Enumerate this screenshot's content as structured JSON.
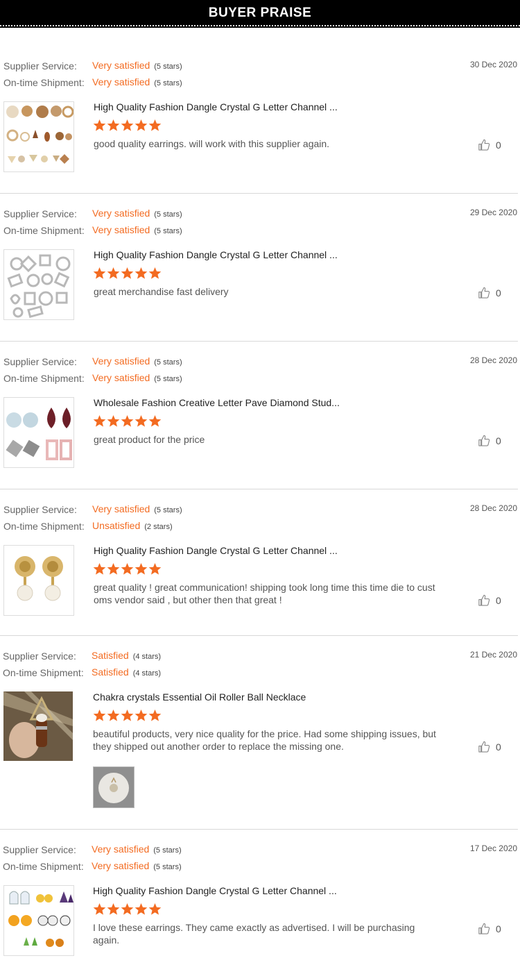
{
  "header": {
    "title": "BUYER PRAISE"
  },
  "labels": {
    "supplier_service": "Supplier Service:",
    "ontime_shipment": "On-time Shipment:"
  },
  "colors": {
    "accent": "#f36b21",
    "banner_bg": "#000000"
  },
  "reviews": [
    {
      "date": "30 Dec 2020",
      "supplier_rating": "Very satisfied",
      "supplier_stars": "(5 stars)",
      "shipment_rating": "Very satisfied",
      "shipment_stars": "(5 stars)",
      "product_title": "High Quality Fashion Dangle Crystal G Letter Channel ...",
      "product_stars": 5,
      "comment": "good quality earrings. will work with this supplier again.",
      "likes": "0",
      "product_image": "earrings-assortment-image"
    },
    {
      "date": "29 Dec 2020",
      "supplier_rating": "Very satisfied",
      "supplier_stars": "(5 stars)",
      "shipment_rating": "Very satisfied",
      "shipment_stars": "(5 stars)",
      "product_title": "High Quality Fashion Dangle Crystal G Letter Channel ...",
      "product_stars": 5,
      "comment": "great merchandise fast delivery",
      "likes": "0",
      "product_image": "rhinestone-buckles-image"
    },
    {
      "date": "28 Dec 2020",
      "supplier_rating": "Very satisfied",
      "supplier_stars": "(5 stars)",
      "shipment_rating": "Very satisfied",
      "shipment_stars": "(5 stars)",
      "product_title": "Wholesale Fashion Creative Letter Pave Diamond Stud...",
      "product_stars": 5,
      "comment": "great product for the price",
      "likes": "0",
      "product_image": "leather-earrings-image"
    },
    {
      "date": "28 Dec 2020",
      "supplier_rating": "Very satisfied",
      "supplier_stars": "(5 stars)",
      "shipment_rating": "Unsatisfied",
      "shipment_stars": "(2 stars)",
      "product_title": "High Quality Fashion Dangle Crystal G Letter Channel ...",
      "product_stars": 5,
      "comment": "great quality ! great communication! shipping took long time this time die to customs vendor said , but other then that great !",
      "likes": "0",
      "product_image": "lion-pearl-earrings-image"
    },
    {
      "date": "21 Dec 2020",
      "supplier_rating": "Satisfied",
      "supplier_stars": "(4 stars)",
      "shipment_rating": "Satisfied",
      "shipment_stars": "(4 stars)",
      "product_title": "Chakra crystals Essential Oil Roller Ball Necklace",
      "product_stars": 5,
      "comment": "beautiful products, very nice quality for the price. Had some shipping issues, but they shipped out another order to replace the missing one.",
      "likes": "0",
      "product_image": "roller-ball-necklace-image",
      "buyer_photo": "buyer-photo-image"
    },
    {
      "date": "17 Dec 2020",
      "supplier_rating": "Very satisfied",
      "supplier_stars": "(5 stars)",
      "shipment_rating": "Very satisfied",
      "shipment_stars": "(5 stars)",
      "product_title": "High Quality Fashion Dangle Crystal G Letter Channel ...",
      "product_stars": 5,
      "comment": "I love these earrings. They came exactly as advertised. I will be purchasing again.",
      "likes": "0",
      "product_image": "halloween-earrings-image"
    }
  ]
}
